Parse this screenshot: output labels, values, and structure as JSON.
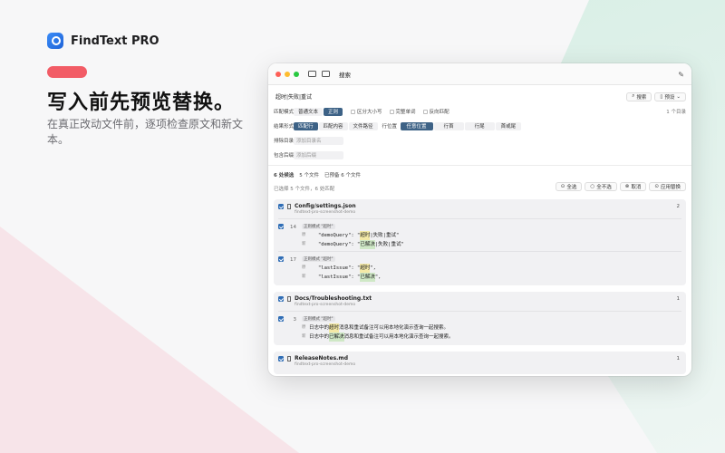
{
  "brand": {
    "name": "FindText PRO"
  },
  "hero": {
    "headline": "写入前先预览替换。",
    "subtitle": "在真正改动文件前，逐项检查原文和新文本。"
  },
  "window": {
    "title": "搜索"
  },
  "search": {
    "query": "超时|失败|重试",
    "search_button": "搜索",
    "preset_button": "预设"
  },
  "match_mode": {
    "label": "匹配模式",
    "options": [
      "普通文本",
      "正则"
    ],
    "selected": 1,
    "checks": [
      "区分大小写",
      "完整单词",
      "反向匹配"
    ],
    "result_count": "1 个目录"
  },
  "result_form": {
    "label": "结果形式",
    "options": [
      "匹配行",
      "匹配内容",
      "文件路径"
    ],
    "selected": 0,
    "position_label": "行位置",
    "position_options": [
      "任意位置",
      "行首",
      "行尾",
      "首或尾"
    ],
    "position_selected": 0
  },
  "exclude": {
    "label": "排除目录",
    "placeholder": "添加目录名"
  },
  "include": {
    "label": "包含后缀",
    "placeholder": "添加后缀"
  },
  "stats": {
    "candidates": "6 处候选",
    "files": "5 个文件",
    "preview": "已预备 6 个文件"
  },
  "selection_info": "已选择 5 个文件，6 处匹配",
  "actions": [
    "全选",
    "全不选",
    "取消",
    "应用替换"
  ],
  "files": [
    {
      "name": "Config/settings.json",
      "path": "findtext-pro-screenshot-demo",
      "count": "2",
      "matches": [
        {
          "line": "14",
          "mode": "正则模式 \"超时\"",
          "old_pre": "\"demoQuery\": \"",
          "old_hl": "超时",
          "old_post": "|失败|重试\"",
          "new_pre": "\"demoQuery\": \"",
          "new_hl": "已解决",
          "new_post": "|失败|重试\""
        },
        {
          "line": "17",
          "mode": "正则模式 \"超时\"",
          "old_pre": "\"lastIssue\": \"",
          "old_hl": "超时",
          "old_post": "\",",
          "new_pre": "\"lastIssue\": \"",
          "new_hl": "已解决",
          "new_post": "\","
        }
      ]
    },
    {
      "name": "Docs/Troubleshooting.txt",
      "path": "findtext-pro-screenshot-demo",
      "count": "1",
      "matches": [
        {
          "line": "3",
          "mode": "正则模式 \"超时\"",
          "old_pre": "日志中的",
          "old_hl": "超时",
          "old_post": "消息和重试备注可以用本地化演示查询一起搜索。",
          "new_pre": "日志中的",
          "new_hl": "已解决",
          "new_post": "消息和重试备注可以用本地化演示查询一起搜索。"
        }
      ]
    },
    {
      "name": "ReleaseNotes.md",
      "path": "findtext-pro-screenshot-demo",
      "count": "1",
      "matches": []
    }
  ],
  "tags": {
    "old": "原",
    "new": "新"
  },
  "colors": {
    "accent": "#3d6286",
    "checkbox": "#2f6db5",
    "pill": "#f25c66",
    "old_highlight": "#f4e9a6",
    "new_highlight": "#cfe8c6"
  }
}
